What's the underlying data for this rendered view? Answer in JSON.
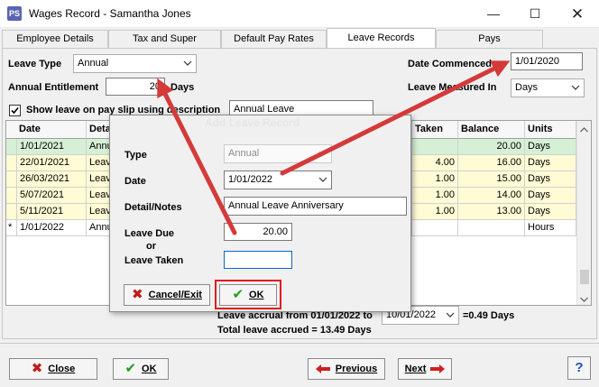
{
  "window": {
    "app_icon": "PS",
    "title": "Wages Record - Samantha Jones",
    "minimize": "—",
    "maximize": "☐",
    "close": "✕"
  },
  "tabs": [
    {
      "label": "Employee Details",
      "active": false
    },
    {
      "label": "Tax and Super",
      "active": false
    },
    {
      "label": "Default Pay Rates",
      "active": false
    },
    {
      "label": "Leave Records",
      "active": true
    },
    {
      "label": "Pays",
      "active": false
    }
  ],
  "form": {
    "leave_type_label": "Leave Type",
    "leave_type_value": "Annual",
    "entitlement_label": "Annual Entitlement",
    "entitlement_value": "20",
    "entitlement_unit": "Days",
    "show_leave_label": "Show leave on pay slip using description",
    "show_leave_checked": true,
    "description_value": "Annual Leave",
    "date_commenced_label": "Date Commenced",
    "date_commenced_value": "1/01/2020",
    "measured_label": "Leave Measured In",
    "measured_value": "Days"
  },
  "grid": {
    "headers": [
      "Date",
      "Deta",
      "Taken",
      "Balance",
      "Units"
    ],
    "rows": [
      {
        "marker": "",
        "date": "1/01/2021",
        "detail": "Annu",
        "taken": "",
        "balance": "20.00",
        "units": "Days",
        "color": "green"
      },
      {
        "marker": "",
        "date": "22/01/2021",
        "detail": "Leav",
        "taken": "4.00",
        "balance": "16.00",
        "units": "Days",
        "color": "yellow"
      },
      {
        "marker": "",
        "date": "26/03/2021",
        "detail": "Leav",
        "taken": "1.00",
        "balance": "15.00",
        "units": "Days",
        "color": "yellow"
      },
      {
        "marker": "",
        "date": "5/07/2021",
        "detail": "Leav",
        "taken": "1.00",
        "balance": "14.00",
        "units": "Days",
        "color": "yellow"
      },
      {
        "marker": "",
        "date": "5/11/2021",
        "detail": "Leav",
        "taken": "1.00",
        "balance": "13.00",
        "units": "Days",
        "color": "yellow"
      },
      {
        "marker": "*",
        "date": "1/01/2022",
        "detail": "Annu",
        "taken": "",
        "balance": "",
        "units": "Hours",
        "color": "white"
      }
    ]
  },
  "accrual": {
    "from_text": "Leave accrual from 01/01/2022 to",
    "to_date": "10/01/2022",
    "result": "=0.49 Days",
    "total": "Total leave accrued = 13.49 Days"
  },
  "dialog": {
    "title": "Add Leave Record",
    "type_label": "Type",
    "type_value": "Annual",
    "date_label": "Date",
    "date_value": "1/01/2022",
    "detail_label": "Detail/Notes",
    "detail_value": "Annual Leave Anniversary",
    "leave_due_label": "Leave Due",
    "or_label": "or",
    "leave_taken_label": "Leave Taken",
    "leave_due_value": "20.00",
    "leave_taken_value": "",
    "cancel_label": "Cancel/Exit",
    "ok_label": "OK"
  },
  "bottom": {
    "close_label": "Close",
    "ok_label": "OK",
    "previous_label": "Previous",
    "next_label": "Next",
    "help_label": "?"
  },
  "colors": {
    "annotation_red": "#d43a3a",
    "ok_highlight": "#e0191f",
    "grid_green": "#d6f0d6",
    "grid_yellow": "#fffbd5"
  }
}
